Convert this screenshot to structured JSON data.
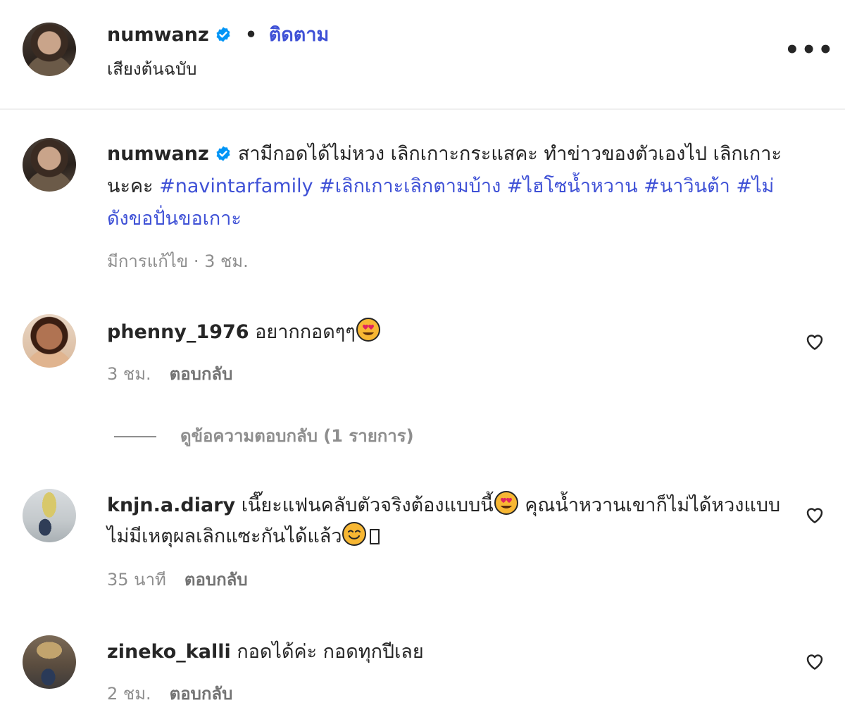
{
  "header": {
    "username": "numwanz",
    "separator": "•",
    "follow_label": "ติดตาม",
    "audio_label": "เสียงต้นฉบับ",
    "more_label": "•••"
  },
  "caption": {
    "username": "numwanz",
    "text": "สามีกอดได้ไม่หวง เลิกเกาะกระแสคะ ทำข่าวของตัวเองไป เลิกเกาะนะคะ",
    "hashtags": [
      "#navintarfamily",
      "#เลิกเกาะเลิกตามบ้าง",
      "#ไฮโซน้ำหวาน",
      "#นาวินต้า",
      "#ไม่ดังขอปั่นขอเกาะ"
    ],
    "meta": "มีการแก้ไข · 3 ชม."
  },
  "comments": [
    {
      "username": "phenny_1976",
      "text": "อยากกอดๆๆ",
      "time": "3 ชม.",
      "reply_label": "ตอบกลับ",
      "view_replies": "ดูข้อความตอบกลับ (1 รายการ)"
    },
    {
      "username": "knjn.a.diary",
      "text_part1": "เนี๊ยะแฟนคลับตัวจริงต้องแบบนี้",
      "text_part2": "คุณน้ำหวานเขาก็ไม่ได้หวงแบบไม่มีเหตุผลเลิกแซะกันได้แล้ว",
      "time": "35 นาที",
      "reply_label": "ตอบกลับ"
    },
    {
      "username": "zineko_kalli",
      "text": "กอดได้ค่ะ กอดทุกปีเลย",
      "time": "2 ชม.",
      "reply_label": "ตอบกลับ"
    }
  ],
  "colors": {
    "link_blue": "#3f51d6",
    "verified_blue": "#0095f6",
    "meta_gray": "#8e8e8e",
    "divider": "#efefef"
  },
  "icons": [
    "verified-badge-icon",
    "more-options-icon",
    "heart-icon",
    "heart-eyes-emoji",
    "smiling-emoji"
  ]
}
